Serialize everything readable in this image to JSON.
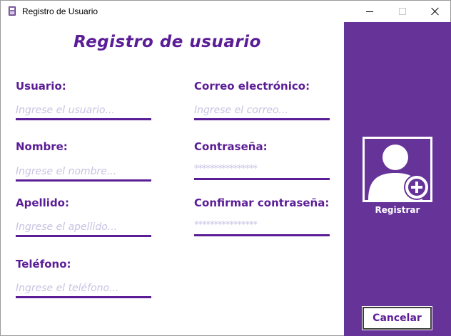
{
  "window": {
    "title": "Registro de Usuario"
  },
  "form": {
    "title": "Registro de usuario",
    "fields": {
      "usuario": {
        "label": "Usuario:",
        "placeholder": "Ingrese el usuario..."
      },
      "nombre": {
        "label": "Nombre:",
        "placeholder": "Ingrese el nombre..."
      },
      "apellido": {
        "label": "Apellido:",
        "placeholder": "Ingrese el apellido..."
      },
      "telefono": {
        "label": "Teléfono:",
        "placeholder": "Ingrese el teléfono..."
      },
      "correo": {
        "label": "Correo electrónico:",
        "placeholder": "Ingrese el correo..."
      },
      "contrasena": {
        "label": "Contraseña:",
        "value": "****************"
      },
      "confirmar": {
        "label": "Confirmar contraseña:",
        "value": "****************"
      }
    }
  },
  "side_panel": {
    "register_icon": "add-user-icon",
    "register_label": "Registrar",
    "cancel_label": "Cancelar"
  },
  "colors": {
    "accent": "#5b1d96",
    "panel": "#663399",
    "placeholder": "#c7c3e3"
  }
}
